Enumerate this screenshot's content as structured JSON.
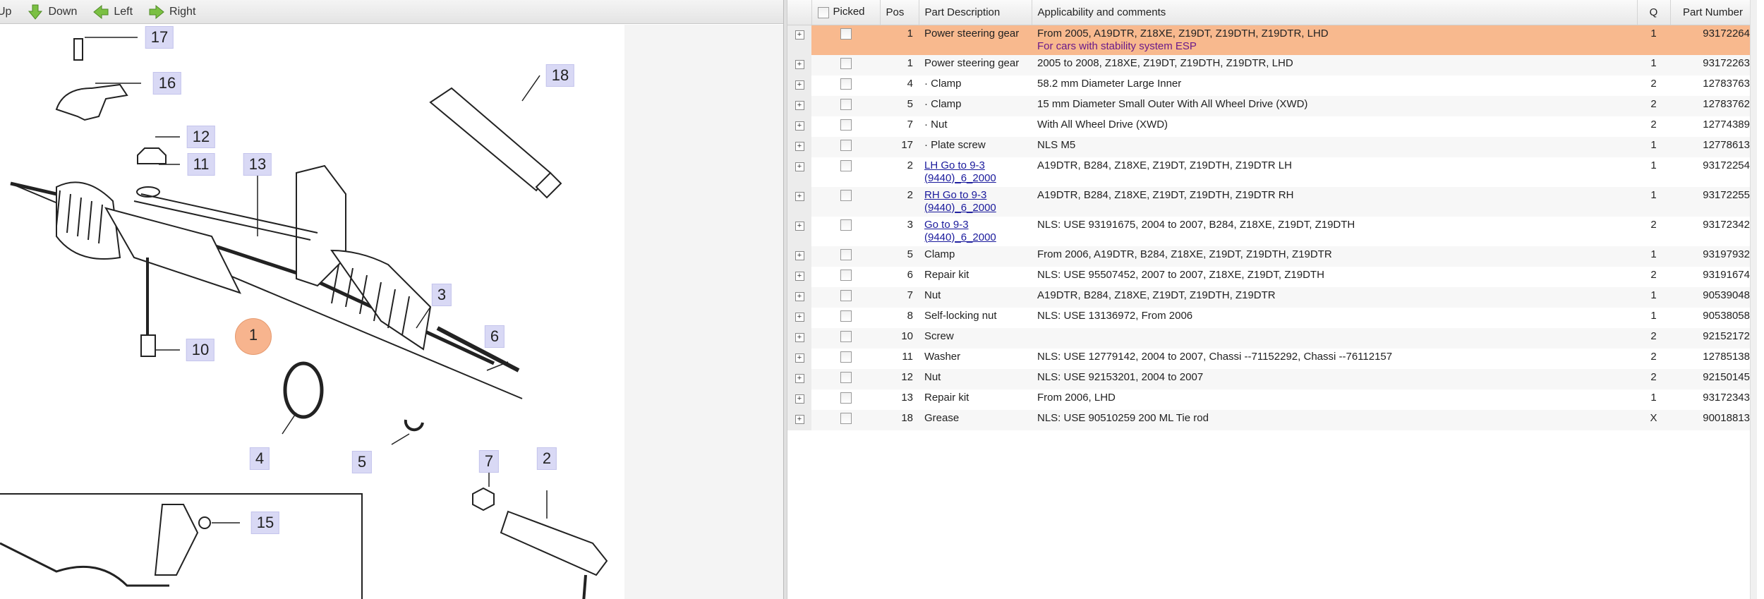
{
  "toolbar": {
    "up": "Up",
    "down": "Down",
    "left": "Left",
    "right": "Right"
  },
  "diagram": {
    "callouts": [
      "17",
      "16",
      "18",
      "12",
      "11",
      "13",
      "3",
      "10",
      "1",
      "6",
      "4",
      "5",
      "7",
      "2",
      "15"
    ],
    "highlight_color": "#f7b48e"
  },
  "table": {
    "headers": {
      "picked": "Picked",
      "pos": "Pos",
      "desc": "Part Description",
      "appl": "Applicability and comments",
      "q": "Q",
      "pn": "Part Number"
    },
    "selected_color": "#f8b98e",
    "rows": [
      {
        "pos": "1",
        "desc": "Power steering gear",
        "appl": "From 2005, A19DTR, Z18XE, Z19DT, Z19DTH, Z19DTR, LHD",
        "note": "For cars with stability system ESP",
        "q": "1",
        "pn": "93172264"
      },
      {
        "pos": "1",
        "desc": "Power steering gear",
        "appl": "2005 to 2008, Z18XE, Z19DT, Z19DTH, Z19DTR, LHD",
        "q": "1",
        "pn": "93172263"
      },
      {
        "pos": "4",
        "desc": "· Clamp",
        "appl": "58.2 mm Diameter Large Inner",
        "q": "2",
        "pn": "12783763"
      },
      {
        "pos": "5",
        "desc": "· Clamp",
        "appl": "15 mm Diameter Small Outer With All Wheel Drive (XWD)",
        "q": "2",
        "pn": "12783762"
      },
      {
        "pos": "7",
        "desc": "· Nut",
        "appl": "With All Wheel Drive (XWD)",
        "q": "2",
        "pn": "12774389"
      },
      {
        "pos": "17",
        "desc": "· Plate screw",
        "appl": "NLS M5",
        "q": "1",
        "pn": "12778613"
      },
      {
        "pos": "2",
        "desc": "LH Go to 9-3 (9440)_6_2000",
        "appl": "A19DTR, B284, Z18XE, Z19DT, Z19DTH, Z19DTR LH",
        "q": "1",
        "pn": "93172254"
      },
      {
        "pos": "2",
        "desc": "RH Go to 9-3 (9440)_6_2000",
        "appl": "A19DTR, B284, Z18XE, Z19DT, Z19DTH, Z19DTR RH",
        "q": "1",
        "pn": "93172255"
      },
      {
        "pos": "3",
        "desc": "Go to 9-3 (9440)_6_2000",
        "appl": "NLS: USE 93191675, 2004 to 2007, B284, Z18XE, Z19DT, Z19DTH",
        "q": "2",
        "pn": "93172342"
      },
      {
        "pos": "5",
        "desc": "Clamp",
        "appl": "From 2006, A19DTR, B284, Z18XE, Z19DT, Z19DTH, Z19DTR",
        "q": "1",
        "pn": "93197932"
      },
      {
        "pos": "6",
        "desc": "Repair kit",
        "appl": "NLS: USE 95507452, 2007 to 2007, Z18XE, Z19DT, Z19DTH",
        "q": "2",
        "pn": "93191674"
      },
      {
        "pos": "7",
        "desc": "Nut",
        "appl": "A19DTR, B284, Z18XE, Z19DT, Z19DTH, Z19DTR",
        "q": "1",
        "pn": "90539048"
      },
      {
        "pos": "8",
        "desc": "Self-locking nut",
        "appl": "NLS: USE 13136972, From 2006",
        "q": "1",
        "pn": "90538058"
      },
      {
        "pos": "10",
        "desc": "Screw",
        "appl": "",
        "q": "2",
        "pn": "92152172"
      },
      {
        "pos": "11",
        "desc": "Washer",
        "appl": "NLS: USE 12779142, 2004 to 2007, Chassi --71152292, Chassi --76112157",
        "q": "2",
        "pn": "12785138"
      },
      {
        "pos": "12",
        "desc": "Nut",
        "appl": "NLS: USE 92153201, 2004 to 2007",
        "q": "2",
        "pn": "92150145"
      },
      {
        "pos": "13",
        "desc": "Repair kit",
        "appl": "From 2006, LHD",
        "q": "1",
        "pn": "93172343"
      },
      {
        "pos": "18",
        "desc": "Grease",
        "appl": "NLS: USE 90510259 200 ML Tie rod",
        "q": "X",
        "pn": "90018813"
      }
    ]
  }
}
